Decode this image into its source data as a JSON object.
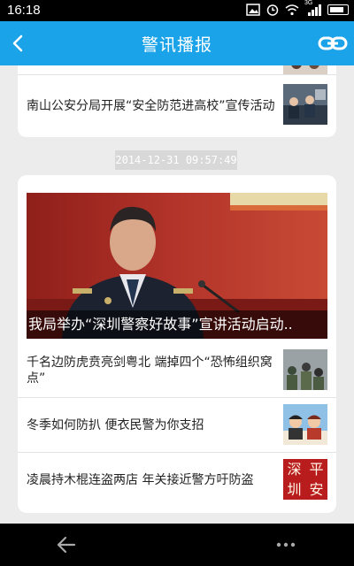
{
  "status_bar": {
    "time": "16:18",
    "network_label": "3G"
  },
  "app_bar": {
    "title": "警讯播报"
  },
  "feed": {
    "card_top": {
      "items": [
        {
          "title": "南山公安分局开展“安全防范进高校”宣传活动"
        }
      ]
    },
    "timestamp": "2014-12-31 09:57:49",
    "card_main": {
      "headline": "我局举办“深圳警察好故事”宣讲活动启动..",
      "items": [
        {
          "title": "千名边防虎贲亮剑粤北 端掉四个“恐怖组织窝点”"
        },
        {
          "title": "冬季如何防扒 便衣民警为你支招"
        },
        {
          "title": "凌晨持木棍连盗两店 年关接近警方吁防盗",
          "thumb_text": [
            "深",
            "平",
            "圳",
            "安"
          ]
        }
      ]
    }
  },
  "colors": {
    "app_bar": "#1aa3e8",
    "background": "#ececec",
    "status_bar": "#000000"
  }
}
